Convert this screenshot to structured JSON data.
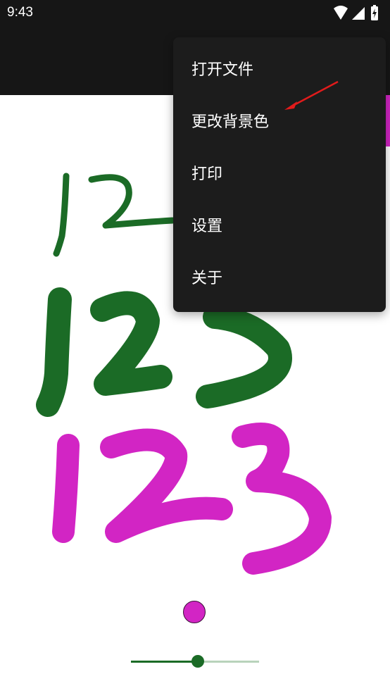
{
  "status_bar": {
    "time": "9:43",
    "icons": [
      "wifi-icon",
      "cellular-signal-icon",
      "battery-charging-icon"
    ]
  },
  "overflow_menu": {
    "items": [
      {
        "label": "打开文件"
      },
      {
        "label": "更改背景色"
      },
      {
        "label": "打印"
      },
      {
        "label": "设置"
      },
      {
        "label": "关于"
      }
    ]
  },
  "drawing": {
    "strokes": [
      {
        "text": "12",
        "color": "#1b6b26"
      },
      {
        "text": "123",
        "color": "#1b6b26"
      },
      {
        "text": "123",
        "color": "#d225c4"
      }
    ]
  },
  "pen": {
    "current_color": "#d225c4",
    "size_fraction": 0.52
  },
  "annotation": {
    "arrow_color": "#e11b1b"
  }
}
